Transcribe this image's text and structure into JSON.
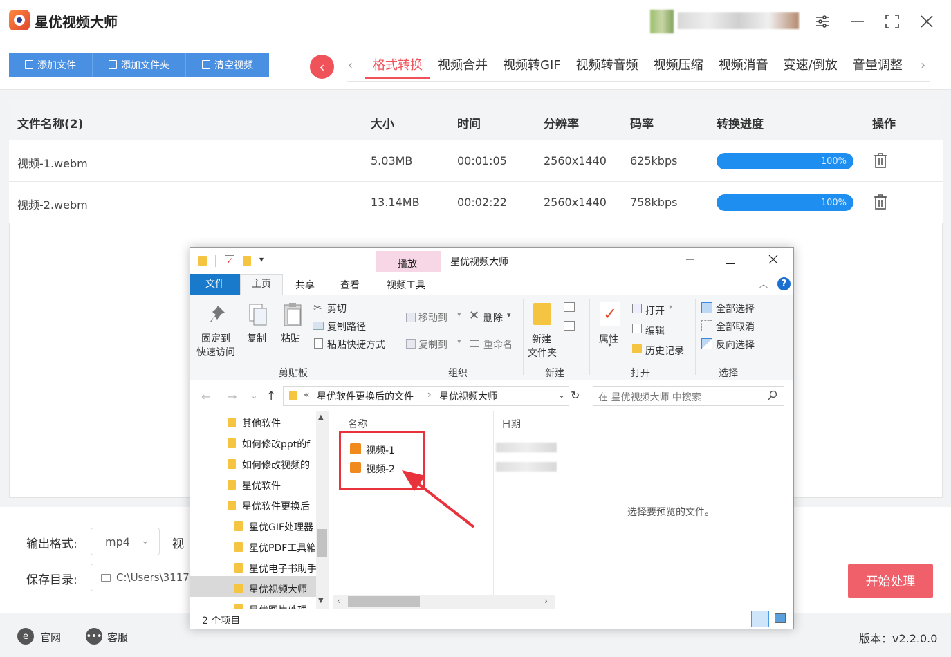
{
  "app": {
    "title": "星优视频大师",
    "version": "版本：v2.2.0.0"
  },
  "window_icons": [
    "settings-icon",
    "minimize-icon",
    "maximize-icon",
    "close-icon"
  ],
  "toolbar": {
    "add_file": "添加文件",
    "add_folder": "添加文件夹",
    "clear": "清空视频"
  },
  "tabs": [
    "格式转换",
    "视频合并",
    "视频转GIF",
    "视频转音频",
    "视频压缩",
    "视频消音",
    "变速/倒放",
    "音量调整"
  ],
  "active_tab": "格式转换",
  "table": {
    "headers": {
      "name": "文件名称(2)",
      "size": "大小",
      "time": "时间",
      "resolution": "分辨率",
      "bitrate": "码率",
      "progress": "转换进度",
      "action": "操作"
    },
    "rows": [
      {
        "name": "视频-1.webm",
        "size": "5.03MB",
        "time": "00:01:05",
        "resolution": "2560x1440",
        "bitrate": "625kbps",
        "progress": "100%",
        "progress_value": 1.0
      },
      {
        "name": "视频-2.webm",
        "size": "13.14MB",
        "time": "00:02:22",
        "resolution": "2560x1440",
        "bitrate": "758kbps",
        "progress": "100%",
        "progress_value": 1.0
      }
    ]
  },
  "bottom": {
    "format_label": "输出格式:",
    "format_value": "mp4",
    "video_label_partial": "视",
    "dir_label": "保存目录:",
    "dir_value": "C:\\Users\\3117",
    "start_button": "开始处理"
  },
  "status": {
    "website": "官网",
    "support": "客服"
  },
  "explorer": {
    "title": "星优视频大师",
    "context_tab": "播放",
    "ribbon_tabs": [
      "文件",
      "主页",
      "共享",
      "查看",
      "视频工具"
    ],
    "clipboard": {
      "pin": "固定到",
      "pin2": "快速访问",
      "copy": "复制",
      "paste": "粘贴",
      "cut": "剪切",
      "copy_path": "复制路径",
      "paste_shortcut": "粘贴快捷方式",
      "group": "剪贴板"
    },
    "organize": {
      "move_to": "移动到",
      "delete": "删除",
      "copy_to": "复制到",
      "rename": "重命名",
      "group": "组织"
    },
    "new": {
      "new_folder": "新建",
      "new_folder2": "文件夹",
      "group": "新建"
    },
    "open": {
      "properties": "属性",
      "open": "打开",
      "edit": "编辑",
      "history": "历史记录",
      "group": "打开"
    },
    "select": {
      "all": "全部选择",
      "none": "全部取消",
      "invert": "反向选择",
      "group": "选择"
    },
    "address": {
      "prefix": "«",
      "part1": "星优软件更换后的文件",
      "sep": "›",
      "part2": "星优视频大师"
    },
    "search_placeholder": "在 星优视频大师 中搜索",
    "nav_items": [
      "其他软件",
      "如何修改ppt的f",
      "如何修改视频的",
      "星优软件",
      "星优软件更换后",
      "星优GIF处理器",
      "星优PDF工具箱",
      "星优电子书助手",
      "星优视频大师",
      "星优图片处理"
    ],
    "columns": {
      "name": "名称",
      "date": "日期"
    },
    "files": [
      "视频-1",
      "视频-2"
    ],
    "preview_text": "选择要预览的文件。",
    "item_count": "2 个项目"
  },
  "colors": {
    "accent_blue": "#4a90e2",
    "accent_red": "#f0525a",
    "progress": "#1f8ef1",
    "highlight_box": "#e8323c"
  }
}
